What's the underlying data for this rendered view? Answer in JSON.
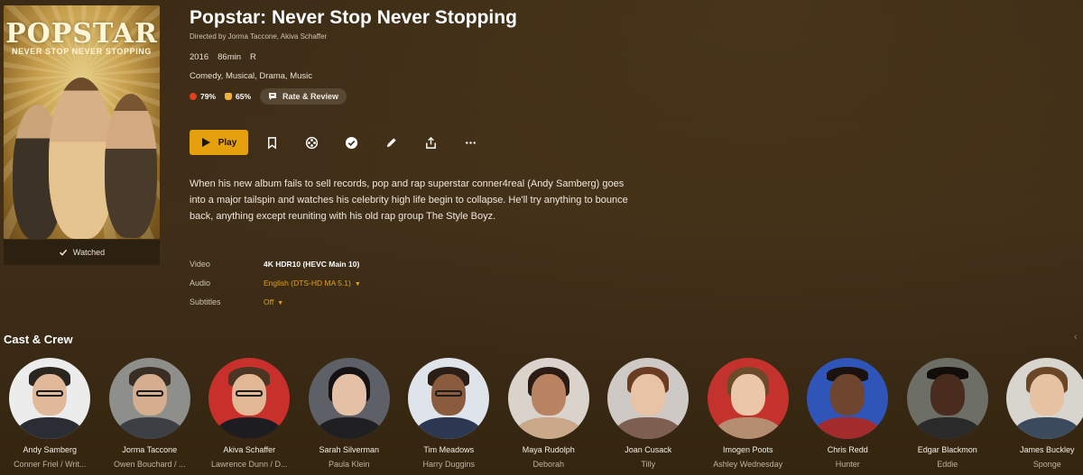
{
  "movie": {
    "title": "Popstar: Never Stop Never Stopping",
    "directed_by": "Directed by Jorma Taccone, Akiva Schaffer",
    "year": "2016",
    "runtime": "86min",
    "rating": "R",
    "genres": "Comedy, Musical, Drama, Music",
    "critic_score": "79%",
    "audience_score": "65%",
    "review_label": "Rate & Review",
    "synopsis": "When his new album fails to sell records, pop and rap superstar conner4real (Andy Samberg) goes into a major tailspin and watches his celebrity high life begin to collapse. He'll try anything to bounce back, anything except reuniting with his old rap group The Style Boyz."
  },
  "poster": {
    "title": "POPSTAR",
    "tagline": "NEVER STOP NEVER STOPPING",
    "watched_label": "Watched"
  },
  "actions": {
    "play_label": "Play",
    "icons": [
      "bookmark-icon",
      "film-reel-icon",
      "check-circle-icon",
      "pencil-icon",
      "share-icon",
      "more-icon"
    ]
  },
  "streams": {
    "video_label": "Video",
    "video_value": "4K HDR10 (HEVC Main 10)",
    "audio_label": "Audio",
    "audio_value": "English (DTS-HD MA 5.1)",
    "subtitles_label": "Subtitles",
    "subtitles_value": "Off"
  },
  "cast": {
    "heading": "Cast & Crew",
    "members": [
      {
        "name": "Andy Samberg",
        "role": "Conner Friel / Writ..."
      },
      {
        "name": "Jorma Taccone",
        "role": "Owen Bouchard / ..."
      },
      {
        "name": "Akiva Schaffer",
        "role": "Lawrence Dunn / D..."
      },
      {
        "name": "Sarah Silverman",
        "role": "Paula Klein"
      },
      {
        "name": "Tim Meadows",
        "role": "Harry Duggins"
      },
      {
        "name": "Maya Rudolph",
        "role": "Deborah"
      },
      {
        "name": "Joan Cusack",
        "role": "Tilly"
      },
      {
        "name": "Imogen Poots",
        "role": "Ashley Wednesday"
      },
      {
        "name": "Chris Redd",
        "role": "Hunter"
      },
      {
        "name": "Edgar Blackmon",
        "role": "Eddie"
      },
      {
        "name": "James Buckley",
        "role": "Sponge"
      }
    ]
  },
  "colors": {
    "accent": "#e5a00d",
    "tomato": "#e0401e",
    "popcorn": "#f0b23c"
  }
}
